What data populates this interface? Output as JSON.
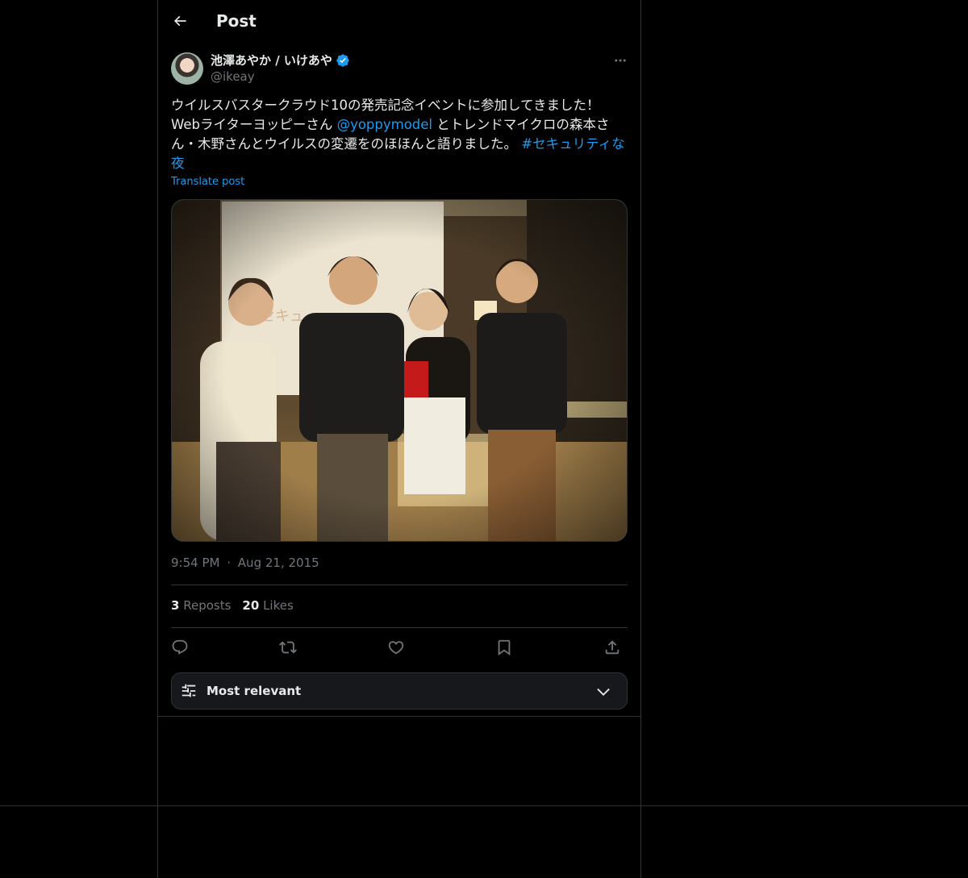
{
  "header": {
    "title": "Post"
  },
  "post": {
    "author_name": "池澤あやか / いけあや",
    "handle": "@ikeay",
    "text_segments": [
      {
        "text": "ウイルスバスタークラウド10の発売記念イベントに参加してきました！\nWebライターヨッピーさん ",
        "link": false
      },
      {
        "text": "@yoppymodel",
        "link": true
      },
      {
        "text": " とトレンドマイクロの森本さん・木野さんとウイルスの変遷をのほほんと語りました。 ",
        "link": false
      },
      {
        "text": "#セキュリティな夜",
        "link": true
      }
    ],
    "translate_label": "Translate post",
    "time": "9:54 PM",
    "date": "Aug 21, 2015",
    "dot": "·",
    "reposts_count": "3",
    "reposts_label": "Reposts",
    "likes_count": "20",
    "likes_label": "Likes"
  },
  "sort": {
    "label": "Most relevant"
  },
  "icons": {
    "back": "arrow-left-icon",
    "verified": "verified-badge-icon",
    "more": "more-icon",
    "reply": "reply-icon",
    "repost": "repost-icon",
    "like": "heart-icon",
    "bookmark": "bookmark-icon",
    "share": "share-icon",
    "sort": "sliders-icon",
    "chevron": "chevron-down-icon"
  },
  "colors": {
    "background": "#000000",
    "text": "#e7e9ea",
    "muted": "#71767b",
    "accent": "#1d9bf0",
    "border": "#2f3336"
  }
}
